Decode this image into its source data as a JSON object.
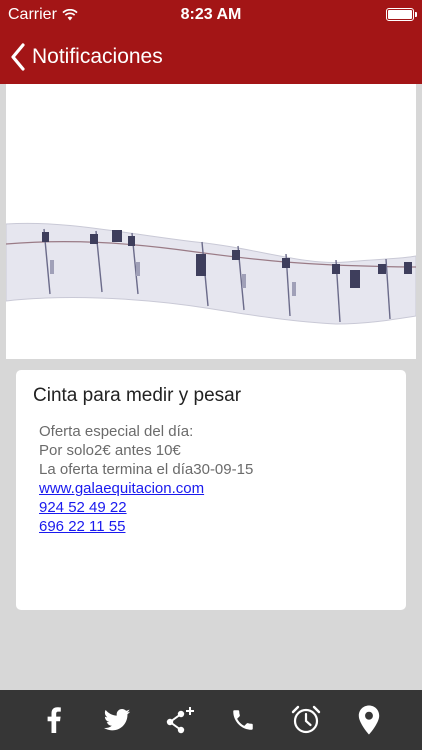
{
  "status_bar": {
    "carrier": "Carrier",
    "time": "8:23 AM"
  },
  "nav": {
    "back_icon": "chevron-left-icon",
    "title": "Notificaciones"
  },
  "hero_image": {
    "description_icon": "measuring-tape-image"
  },
  "card": {
    "heading": "Cinta para medir y pesar",
    "lines": [
      "Oferta especial del día:",
      "Por solo2€  antes 10€",
      "La oferta termina el día30-09-15"
    ],
    "links": [
      "www.galaequitacion.com",
      "924 52 49 22",
      "696 22 11 55"
    ]
  },
  "tab_bar": {
    "tabs": [
      "facebook-icon",
      "twitter-icon",
      "share-icon",
      "phone-icon",
      "alarm-clock-icon",
      "location-pin-icon"
    ]
  },
  "colors": {
    "brand": "#a31516",
    "tab_bar": "#363636",
    "background": "#d7d7d7",
    "link": "#1a1aee"
  }
}
